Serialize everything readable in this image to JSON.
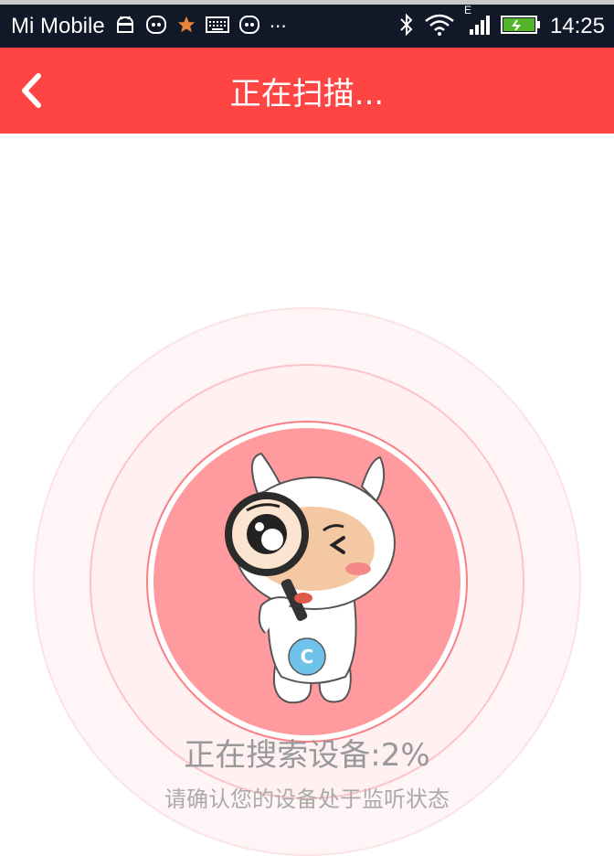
{
  "status_bar": {
    "carrier": "Mi Mobile",
    "time": "14:25",
    "network_type": "E",
    "icons_left": [
      "android-icon",
      "notification-app-icon",
      "star-icon",
      "keyboard-icon",
      "notification-app-icon",
      "more-dots-icon"
    ],
    "icons_right": [
      "bluetooth-icon",
      "wifi-icon",
      "signal-icon",
      "battery-charging-icon"
    ],
    "more_label": "···"
  },
  "header": {
    "title": "正在扫描...",
    "back_icon": "chevron-left-icon",
    "background_color": "#ff4444"
  },
  "scan": {
    "progress_text": "正在搜索设备:2%",
    "progress_percent": 2,
    "hint_text": "请确认您的设备处于监听状态",
    "mascot_badge_letter": "C"
  }
}
